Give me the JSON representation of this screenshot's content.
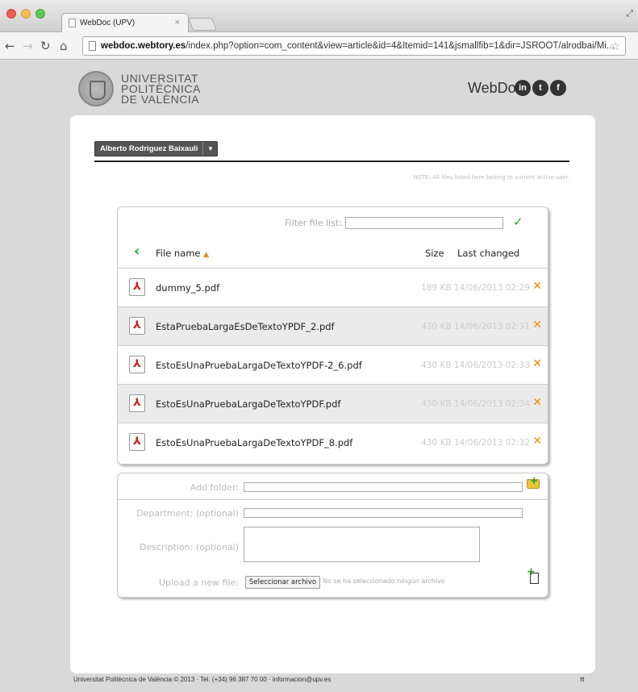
{
  "browser": {
    "tab_title": "WebDoc (UPV)",
    "tab_close": "×",
    "url_domain": "webdoc.webtory.es",
    "url_path": "/index.php?option=com_content&view=article&id=4&Itemid=141&jsmallfib=1&dir=JSROOT/alrodbai/Mi..."
  },
  "header": {
    "logo_line1": "UNIVERSITAT",
    "logo_line2": "POLITÈCNICA",
    "logo_line3": "DE VALÈNCIA",
    "brand": "WebDoc",
    "social": [
      "in",
      "t",
      "f"
    ]
  },
  "user_select": {
    "value": "Alberto Rodriguez Baixauli"
  },
  "note": "NOTE: All files listed here belong to current active user.",
  "file_list": {
    "filter_label": "Filter file list:",
    "columns": {
      "name": "File name",
      "size": "Size",
      "date": "Last changed"
    },
    "rows": [
      {
        "name": "dummy_5.pdf",
        "meta": "189 KB 14/06/2013 02:29"
      },
      {
        "name": "EstaPruebaLargaEsDeTextoYPDF_2.pdf",
        "meta": "430 KB 14/06/2013 02:31"
      },
      {
        "name": "EstoEsUnaPruebaLargaDeTextoYPDF-2_6.pdf",
        "meta": "430 KB 14/06/2013 02:33"
      },
      {
        "name": "EstoEsUnaPruebaLargaDeTextoYPDF.pdf",
        "meta": "430 KB 14/06/2013 02:34"
      },
      {
        "name": "EstoEsUnaPruebaLargaDeTextoYPDF_8.pdf",
        "meta": "430 KB 14/06/2013 02:32"
      }
    ]
  },
  "form": {
    "add_folder_label": "Add folder:",
    "department_label": "Department: (optional)",
    "description_label": "Description: (optional)",
    "upload_label": "Upload a new file:",
    "file_button": "Seleccionar archivo",
    "file_status": "No se ha seleccionado ningún archivo"
  },
  "footer": {
    "text": "Universitat Politècnica de València © 2013 · Tel. (+34) 96 387 70 00 · informacion@upv.es",
    "pi": "π"
  },
  "colors": {
    "accent_green": "#1cae1c",
    "accent_orange": "#f08a00",
    "pdf_red": "#d21c1c"
  }
}
